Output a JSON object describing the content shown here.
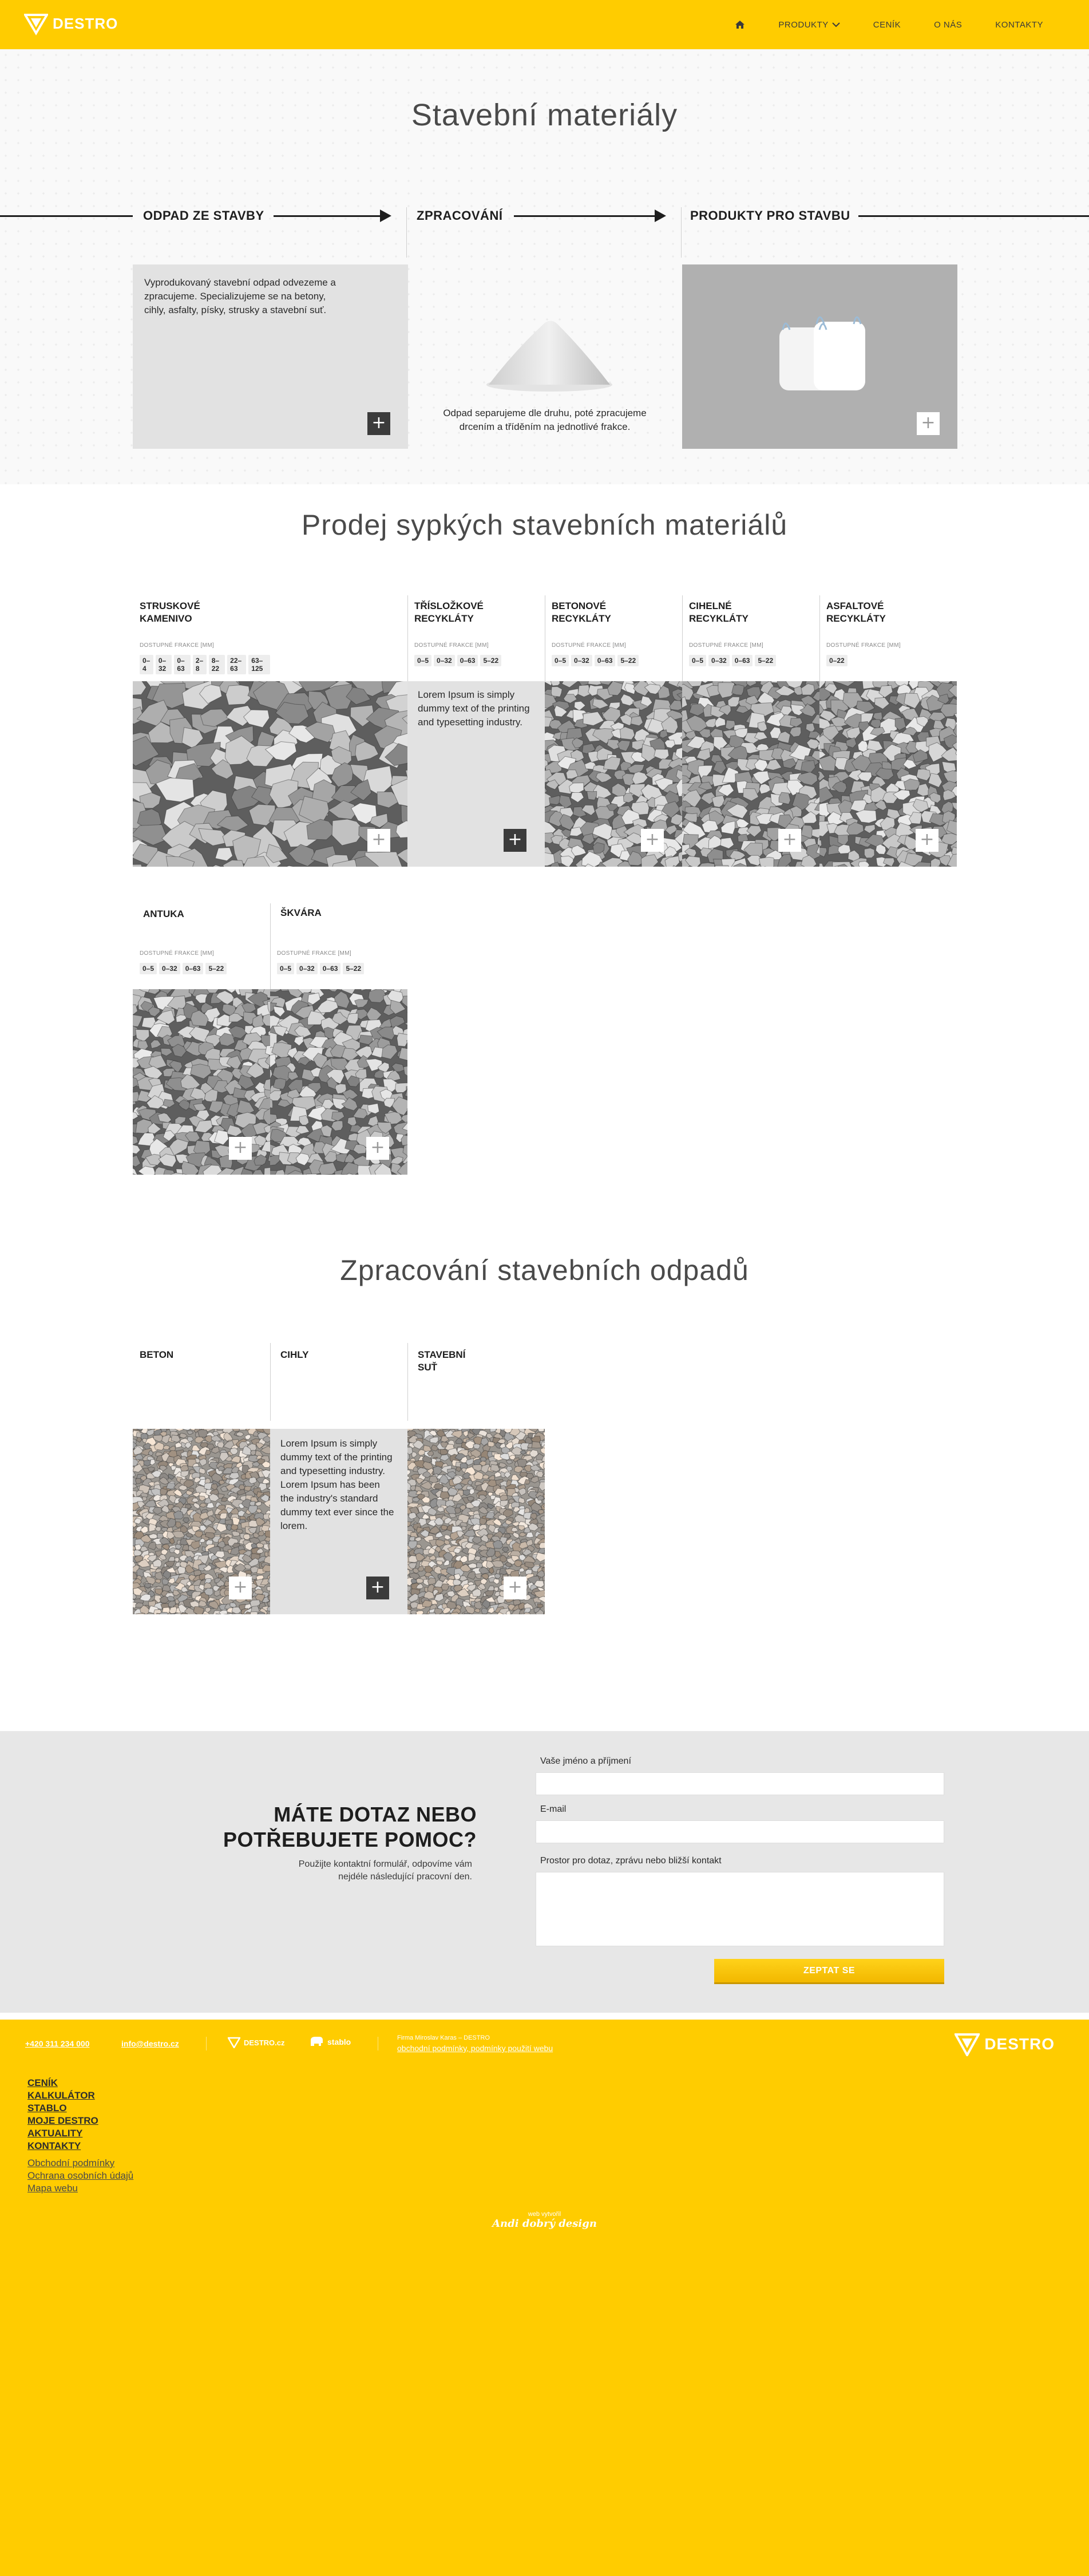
{
  "header": {
    "logo_text": "DESTRO",
    "nav": [
      {
        "label": "",
        "icon": "home-icon"
      },
      {
        "label": "PRODUKTY",
        "icon": "chevron-down-icon"
      },
      {
        "label": "CENÍK"
      },
      {
        "label": "O NÁS"
      },
      {
        "label": "KONTAKTY"
      }
    ],
    "accent_color": "#ffcc00"
  },
  "hero": {
    "title": "Stavební materiály",
    "steps": [
      {
        "label": "ODPAD ZE STAVBY",
        "text": "Vyprodukovaný stavební odpad odvezeme a zpracujeme. Specializujeme se na betony, cihly, asfalty, písky, strusky a stavební suť."
      },
      {
        "label": "ZPRACOVÁNÍ",
        "text": "Odpad separujeme dle druhu, poté zpracujeme drcením a tříděním na jednotlivé frakce."
      },
      {
        "label": "PRODUKTY PRO STAVBU",
        "text": ""
      }
    ]
  },
  "prodej": {
    "title": "Prodej sypkých stavebních materiálů",
    "fraction_label": "DOSTUPNÉ FRAKCE [mm]",
    "products": [
      {
        "name": "STRUSKOVÉ KAMENIVO",
        "fractions": [
          "0–4",
          "0–32",
          "0–63",
          "2–8",
          "8–22",
          "22–63",
          "63–125"
        ]
      },
      {
        "name": "TŘÍSLOŽKOVÉ RECYKLÁTY",
        "fractions": [
          "0–5",
          "0–32",
          "0–63",
          "5–22"
        ],
        "hover_text": "Lorem Ipsum is simply dummy text of the printing and typesetting industry."
      },
      {
        "name": "BETONOVÉ RECYKLÁTY",
        "fractions": [
          "0–5",
          "0–32",
          "0–63",
          "5–22"
        ]
      },
      {
        "name": "CIHELNÉ RECYKLÁTY",
        "fractions": [
          "0–5",
          "0–32",
          "0–63",
          "5–22"
        ]
      },
      {
        "name": "ASFALTOVÉ RECYKLÁTY",
        "fractions": [
          "0–22"
        ]
      },
      {
        "name": "ANTUKA",
        "fractions": [
          "0–5",
          "0–32",
          "0–63",
          "5–22"
        ]
      },
      {
        "name": "ŠKVÁRA",
        "fractions": [
          "0–5",
          "0–32",
          "0–63",
          "5–22"
        ]
      }
    ]
  },
  "zpracovani": {
    "title": "Zpracování stavebních odpadů",
    "items": [
      {
        "name": "BETON"
      },
      {
        "name": "CIHLY",
        "hover_text": "Lorem Ipsum is simply dummy text of the printing and typesetting industry. Lorem Ipsum has been the industry's standard dummy text ever since the lorem."
      },
      {
        "name": "STAVEBNÍ SUŤ"
      }
    ]
  },
  "contact": {
    "title_line1": "MÁTE DOTAZ NEBO",
    "title_line2": "POTŘEBUJETE POMOC?",
    "desc": "Použijte kontaktní formulář, odpovíme vám nejdéle následující pracovní den.",
    "name_label": "Vaše jméno a příjmení",
    "email_label": "E-mail",
    "message_label": "Prostor pro dotaz, zprávu nebo bližší kontakt",
    "submit": "ZEPTAT SE"
  },
  "footer": {
    "phone": "+420 311 234 000",
    "email": "info@destro.cz",
    "brand1": "DESTRO.cz",
    "brand2": "stablo",
    "legal_small": "Firma Miroslav Karas – DESTRO",
    "legal_link": "obchodní podmínky, podmínky použití webu",
    "logo_text": "DESTRO",
    "nav": [
      "CENÍK",
      "KALKULÁTOR",
      "STABLO",
      "MOJE DESTRO",
      "AKTUALITY",
      "KONTAKTY"
    ],
    "nav_sub": [
      "Obchodní podmínky",
      "Ochrana osobních údajů",
      "Mapa webu"
    ],
    "credit_small": "web vytvořil",
    "credit_brand": "Andi dobrý design"
  }
}
